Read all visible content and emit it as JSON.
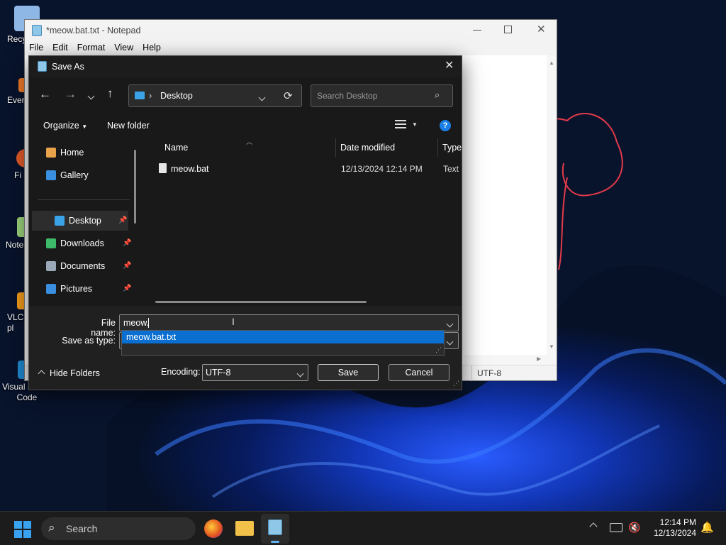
{
  "desktop": {
    "icons": [
      {
        "label": "Recy"
      },
      {
        "label": "Ever"
      },
      {
        "label": "Fi"
      },
      {
        "label": "Note"
      },
      {
        "label": "VLC\npl"
      },
      {
        "label": "Visual Studio\nCode"
      }
    ]
  },
  "notepad": {
    "title": "*meow.bat.txt - Notepad",
    "menu": [
      "File",
      "Edit",
      "Format",
      "View",
      "Help"
    ],
    "status_encoding": "UTF-8"
  },
  "dialog": {
    "title": "Save As",
    "address_path": "Desktop",
    "search_placeholder": "Search Desktop",
    "commands": {
      "organize": "Organize",
      "new_folder": "New folder"
    },
    "sidebar": [
      {
        "label": "Home",
        "icon": "home-icon",
        "pinned": false
      },
      {
        "label": "Gallery",
        "icon": "gallery-icon",
        "pinned": false
      },
      {
        "label": "Desktop",
        "icon": "desktop-icon",
        "pinned": true
      },
      {
        "label": "Downloads",
        "icon": "download-icon",
        "pinned": true
      },
      {
        "label": "Documents",
        "icon": "documents-icon",
        "pinned": true
      },
      {
        "label": "Pictures",
        "icon": "pictures-icon",
        "pinned": true
      }
    ],
    "columns": {
      "name": "Name",
      "date": "Date modified",
      "type": "Type"
    },
    "files": [
      {
        "name": "meow.bat",
        "date": "12/13/2024 12:14 PM",
        "type": "Text D"
      }
    ],
    "file_name_label": "File name:",
    "file_name_value": "meow.",
    "autocomplete": [
      "meow.bat.txt"
    ],
    "save_as_type_label": "Save as type:",
    "hide_folders": "Hide Folders",
    "encoding_label": "Encoding:",
    "encoding_value": "UTF-8",
    "save": "Save",
    "cancel": "Cancel"
  },
  "taskbar": {
    "search_label": "Search",
    "time": "12:14 PM",
    "date": "12/13/2024"
  },
  "colors": {
    "accent": "#0078d4",
    "selection": "#0a6fd1",
    "dialog_bg": "#202020",
    "taskbar_bg": "#1c1c1c"
  }
}
